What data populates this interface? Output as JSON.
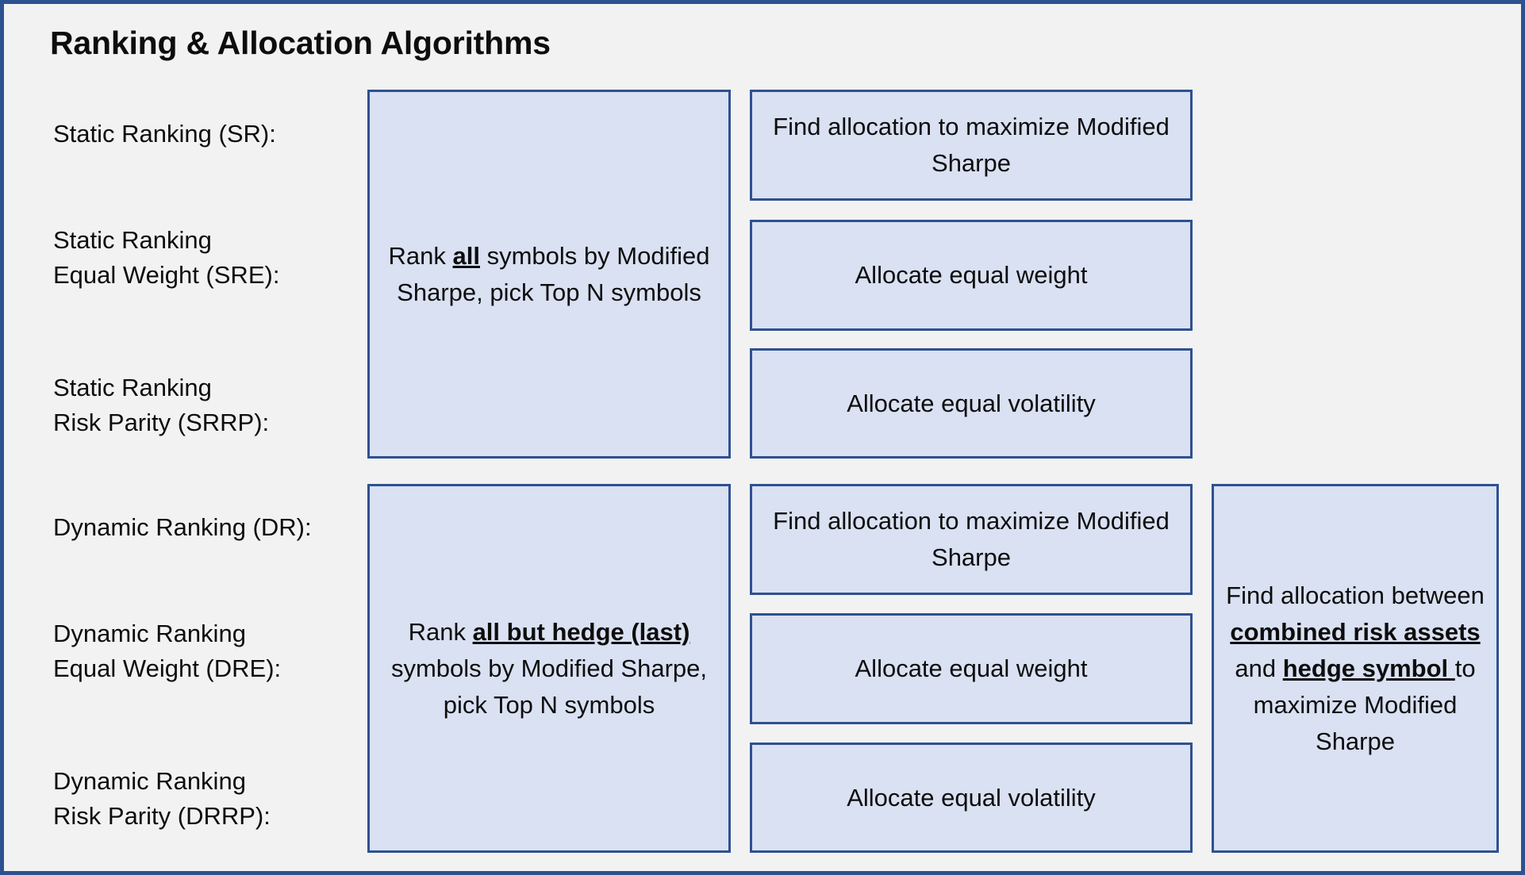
{
  "diagram": {
    "title": "Ranking & Allocation Algorithms",
    "colors": {
      "background": "#F2F2F2",
      "frame_border": "#2E5190",
      "box_fill": "#D9E1F2",
      "box_border": "#2E5190",
      "text": "#0D0D0D"
    }
  },
  "rows": [
    {
      "id": "sr",
      "line1": "Static Ranking (SR):",
      "line2": ""
    },
    {
      "id": "sre",
      "line1": "Static Ranking",
      "line2": "Equal Weight (SRE):"
    },
    {
      "id": "srrp",
      "line1": "Static Ranking",
      "line2": "Risk Parity (SRRP):"
    },
    {
      "id": "dr",
      "line1": "Dynamic Ranking (DR):",
      "line2": ""
    },
    {
      "id": "dre",
      "line1": "Dynamic Ranking",
      "line2": "Equal Weight (DRE):"
    },
    {
      "id": "drrp",
      "line1": "Dynamic Ranking",
      "line2": "Risk Parity (DRRP):"
    }
  ],
  "boxes": {
    "rank_static": {
      "text": "Rank all symbols by Modified Sharpe, pick Top N symbols",
      "html": "Rank <b>all</b> symbols by Modified Sharpe, pick Top N symbols",
      "emphasis": [
        "all"
      ]
    },
    "rank_dynamic": {
      "text": "Rank all but hedge (last) symbols by Modified Sharpe, pick Top N symbols",
      "html": "Rank <b>all but hedge (last)</b> symbols by Modified Sharpe, pick Top N symbols",
      "emphasis": [
        "all but hedge (last)"
      ]
    },
    "sr_alloc": {
      "text": "Find allocation to maximize Modified Sharpe",
      "html": "Find allocation to maximize Modified Sharpe"
    },
    "sre_alloc": {
      "text": "Allocate equal weight",
      "html": "Allocate equal weight"
    },
    "srrp_alloc": {
      "text": "Allocate equal volatility",
      "html": "Allocate equal volatility"
    },
    "dr_alloc": {
      "text": "Find allocation to maximize Modified Sharpe",
      "html": "Find allocation to maximize Modified Sharpe"
    },
    "dre_alloc": {
      "text": "Allocate equal weight",
      "html": "Allocate equal weight"
    },
    "drrp_alloc": {
      "text": "Allocate equal volatility",
      "html": "Allocate equal volatility"
    },
    "hedge_alloc": {
      "text": "Find allocation between combined risk assets and hedge symbol to maximize Modified Sharpe",
      "html": "Find allocation between <b>combined risk assets </b>and <b>hedge symbol </b>to maximize Modified Sharpe",
      "emphasis": [
        "combined risk assets",
        "hedge symbol"
      ]
    }
  }
}
